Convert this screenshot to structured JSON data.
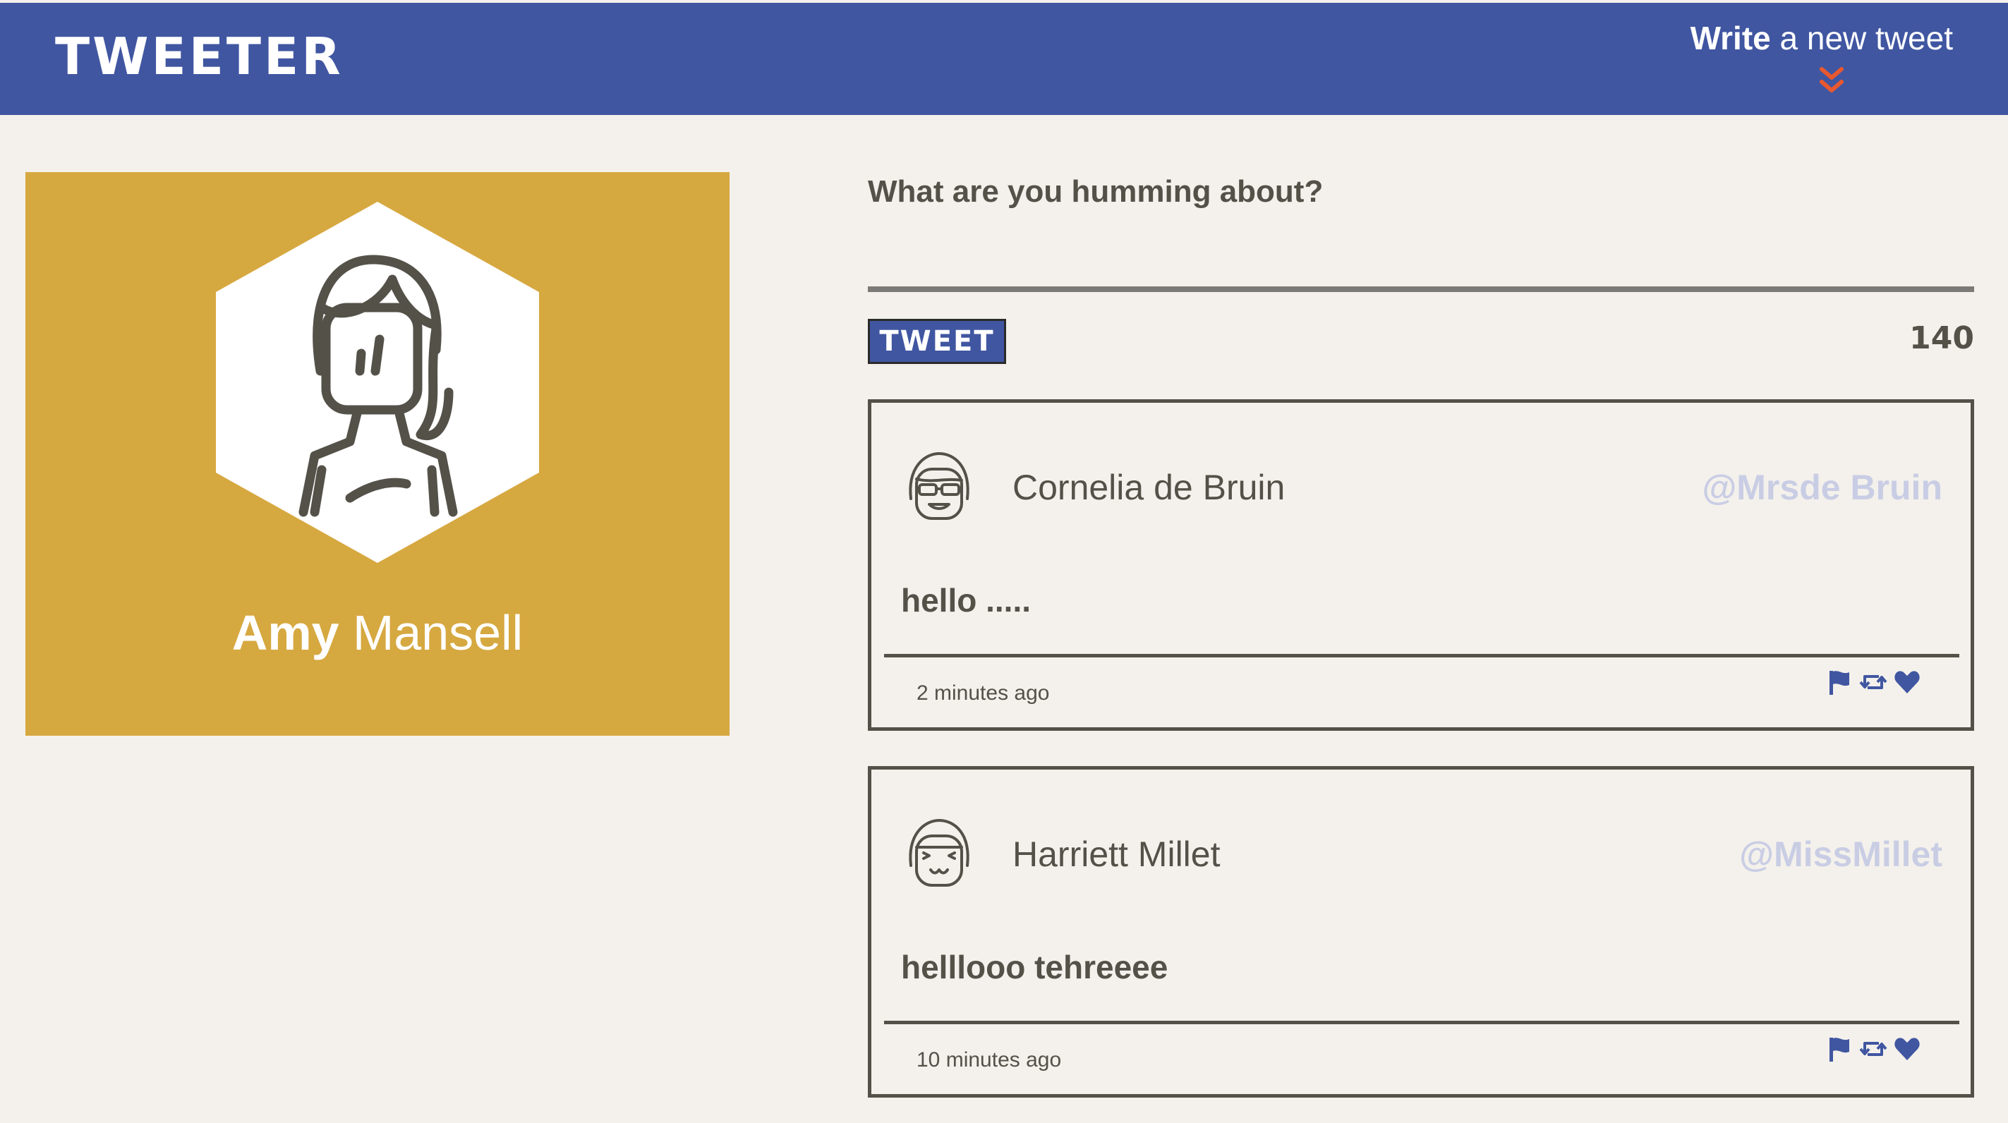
{
  "header": {
    "brand": "TWEETER",
    "compose_bold": "Write",
    "compose_rest": " a new tweet",
    "chevron_icon": "double-chevron-down-icon"
  },
  "profile": {
    "first_name": "Amy",
    "last_name": " Mansell",
    "avatar_icon": "girl-avatar-icon",
    "background_color": "#d6a840"
  },
  "composer": {
    "placeholder": "What are you humming about?",
    "value": "",
    "button_label": "TWEET",
    "counter": "140"
  },
  "tweets": [
    {
      "author": "Cornelia de Bruin",
      "handle": "@Mrsde Bruin",
      "content": "hello .....",
      "time": "2 minutes ago",
      "avatar_icon": "sunglasses-avatar-icon"
    },
    {
      "author": "Harriett Millet",
      "handle": "@MissMillet",
      "content": "helllooo tehreeee",
      "time": "10 minutes ago",
      "avatar_icon": "happy-avatar-icon"
    }
  ],
  "action_icons": [
    "flag-icon",
    "retweet-icon",
    "heart-icon"
  ],
  "colors": {
    "accent": "#4056a1",
    "background": "#f4f1ec",
    "text": "#545149",
    "handle": "#c9cde4",
    "chevron": "#e8582f"
  }
}
